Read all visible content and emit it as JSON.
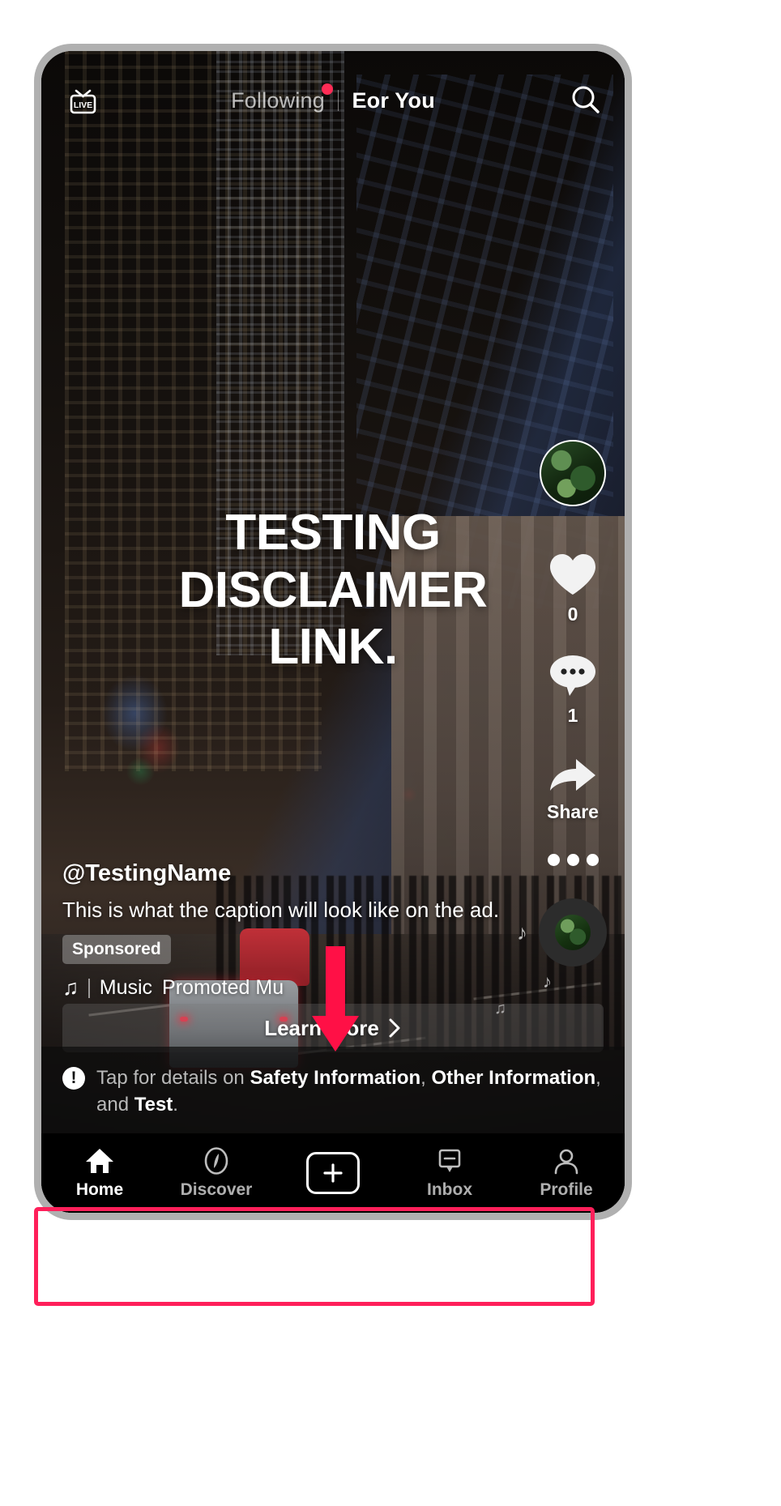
{
  "app": {
    "name": "TikTok",
    "accent_color": "#fe2c55",
    "annotation_color": "#ff1f5a"
  },
  "top_nav": {
    "live_label": "LIVE",
    "tabs": [
      {
        "label": "Following",
        "active": false,
        "has_badge": true
      },
      {
        "label": "Eor You",
        "active": true,
        "has_badge": false
      }
    ],
    "search_icon": "search-icon"
  },
  "video": {
    "creative_text_lines": [
      "TESTING",
      "DISCLAIMER",
      "LINK."
    ]
  },
  "action_rail": {
    "avatar_alt": "profile-avatar",
    "like": {
      "icon": "heart-icon",
      "count": "0"
    },
    "comment": {
      "icon": "comment-bubble-icon",
      "count": "1"
    },
    "share": {
      "icon": "share-arrow-icon",
      "label": "Share"
    },
    "more": {
      "icon": "more-dots-icon"
    },
    "music_disc": {
      "icon": "music-disc-icon"
    }
  },
  "info": {
    "handle": "@TestingName",
    "caption": "This is what the caption will look like on the ad.",
    "sponsored_label": "Sponsored",
    "music_icon": "music-note-icon",
    "music_label": "Music",
    "music_title": "Promoted Mu"
  },
  "cta": {
    "label": "Learn more",
    "chevron": "chevron-right-icon"
  },
  "disclaimer": {
    "icon": "exclamation-icon",
    "prefix": "Tap for details on ",
    "link_1": "Safety Information",
    "sep_1": ", ",
    "link_2": "Other Information",
    "sep_2": ", and ",
    "link_3": "Test",
    "suffix": "."
  },
  "tab_bar": {
    "items": [
      {
        "label": "Home",
        "icon": "home-icon",
        "active": true
      },
      {
        "label": "Discover",
        "icon": "compass-icon",
        "active": false
      },
      {
        "label": "",
        "icon": "plus-icon",
        "active": false
      },
      {
        "label": "Inbox",
        "icon": "inbox-icon",
        "active": false
      },
      {
        "label": "Profile",
        "icon": "person-icon",
        "active": false
      }
    ]
  }
}
